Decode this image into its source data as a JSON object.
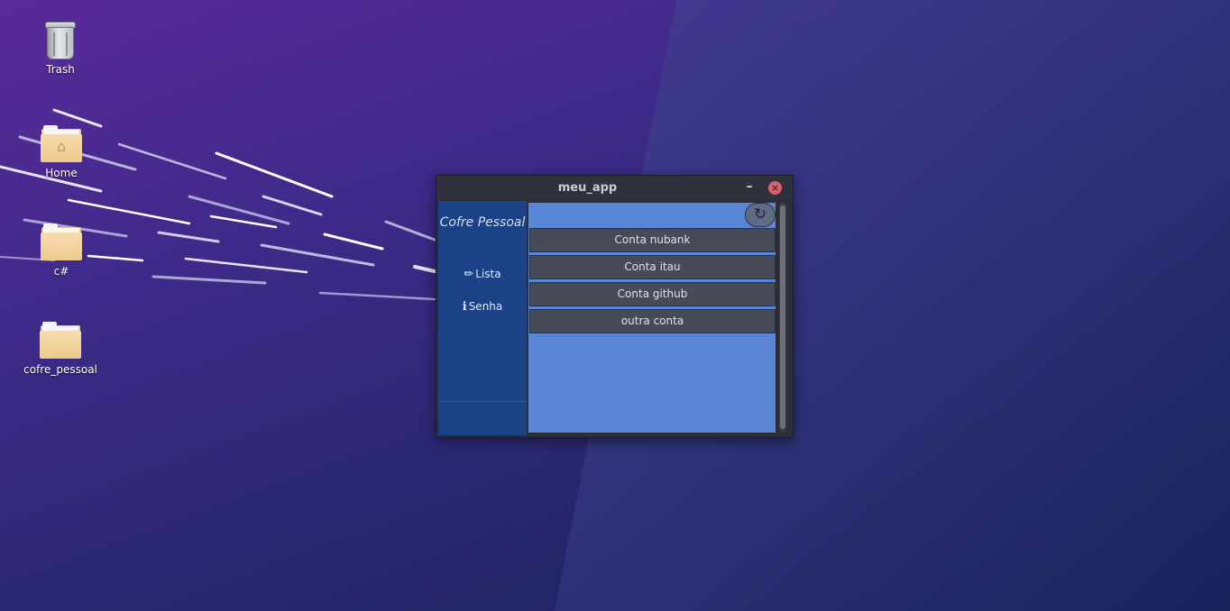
{
  "desktop": {
    "icons": [
      {
        "label": "Trash",
        "icon": "trash-icon"
      },
      {
        "label": "Home",
        "icon": "home-folder-icon"
      },
      {
        "label": "c#",
        "icon": "folder-icon"
      },
      {
        "label": "cofre_pessoal",
        "icon": "folder-icon"
      }
    ]
  },
  "window": {
    "title": "meu_app",
    "minimize_glyph": "–",
    "close_glyph": "×"
  },
  "sidebar": {
    "brand": "Cofre Pessoal",
    "items": [
      {
        "label": "Lista",
        "icon": "pencil-icon",
        "glyph": "✏"
      },
      {
        "label": "Senha",
        "icon": "key-icon",
        "glyph": "ℹ"
      }
    ]
  },
  "content": {
    "refresh_glyph": "↻",
    "accounts": [
      "Conta nubank",
      "Conta itau",
      "Conta github",
      "outra conta"
    ]
  },
  "colors": {
    "sidebar": "#1b4286",
    "content": "#5a86d6",
    "button": "#474b57",
    "close": "#e0606a"
  }
}
